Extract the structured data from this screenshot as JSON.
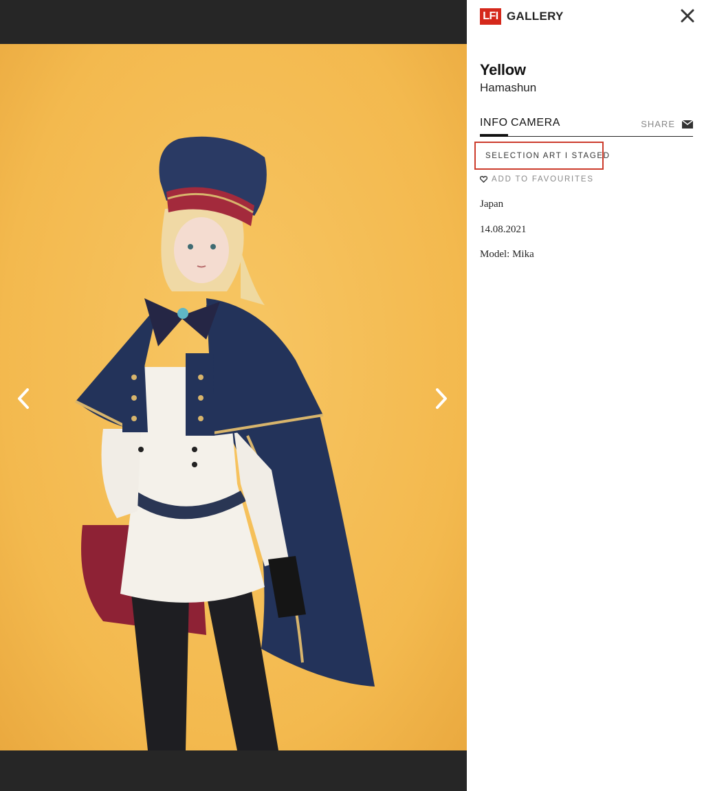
{
  "panel": {
    "logo_text": "LFI",
    "gallery_label": "GALLERY",
    "title": "Yellow",
    "author": "Hamashun",
    "tabs": [
      {
        "label": "INFO",
        "active": true
      },
      {
        "label": "CAMERA",
        "active": false
      }
    ],
    "share_label": "SHARE",
    "tag_label": "SELECTION ART I STAGED",
    "favourites_label": "ADD TO FAVOURITES",
    "meta": {
      "location": "Japan",
      "date": "14.08.2021",
      "model": "Model: Mika"
    }
  },
  "colors": {
    "brand_red": "#d5281b",
    "tag_outline": "#cc3b2b",
    "viewer_bg": "#262626",
    "photo_bg": "#f3b94e"
  },
  "icons": {
    "close": "close-icon",
    "share": "envelope-icon",
    "favourite": "heart-icon",
    "prev": "chevron-left-icon",
    "next": "chevron-right-icon"
  }
}
